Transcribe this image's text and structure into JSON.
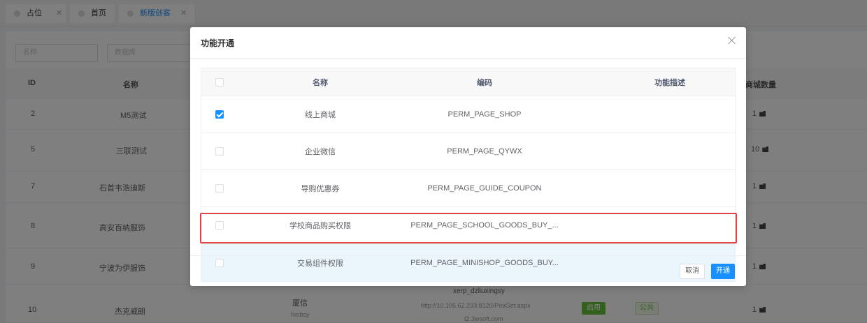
{
  "tabs": [
    {
      "label": "占位"
    },
    {
      "label": "首页"
    },
    {
      "label": "新版创客"
    }
  ],
  "filters": {
    "name_placeholder": "名称",
    "db_placeholder": "数据库"
  },
  "bg_table": {
    "headers": {
      "id": "ID",
      "name": "名称",
      "mall_count": "商城数量"
    },
    "rows": [
      {
        "id": "2",
        "name": "M5测试",
        "mall_count": "1"
      },
      {
        "id": "5",
        "name": "三联测试",
        "mall_count": "10"
      },
      {
        "id": "7",
        "name": "石首韦浩迪斯",
        "mall_count": "1"
      },
      {
        "id": "8",
        "name": "高安百纳服饰",
        "mall_count": "1"
      },
      {
        "id": "9",
        "name": "宁波为伊服饰",
        "mall_count": "1"
      },
      {
        "id": "10",
        "name": "杰克威朗",
        "mall_count": "1",
        "brand": "厦信",
        "brand_sub": "hmbsy",
        "erp": "xerp_dzliuxingsy",
        "url": "http://10.105.62.233:8120/PosGet.aspx",
        "url_sub": "t2.3wsoft.com",
        "status": "启用",
        "scope": "公共"
      }
    ]
  },
  "modal": {
    "title": "功能开通",
    "columns": {
      "name": "名称",
      "code": "编码",
      "desc": "功能描述"
    },
    "rows": [
      {
        "name": "线上商城",
        "code": "PERM_PAGE_SHOP",
        "desc": "",
        "checked": true
      },
      {
        "name": "企业微信",
        "code": "PERM_PAGE_QYWX",
        "desc": "",
        "checked": false
      },
      {
        "name": "导购优惠券",
        "code": "PERM_PAGE_GUIDE_COUPON",
        "desc": "",
        "checked": false
      },
      {
        "name": "学校商品购买权限",
        "code": "PERM_PAGE_SCHOOL_GOODS_BUY_...",
        "desc": "",
        "checked": false
      },
      {
        "name": "交易组件权限",
        "code": "PERM_PAGE_MINISHOP_GOODS_BUY...",
        "desc": "",
        "checked": false
      }
    ],
    "cancel_label": "取消",
    "confirm_label": "开通"
  },
  "colors": {
    "primary": "#1890ff",
    "highlight": "#e04545",
    "success": "#67c23a"
  }
}
